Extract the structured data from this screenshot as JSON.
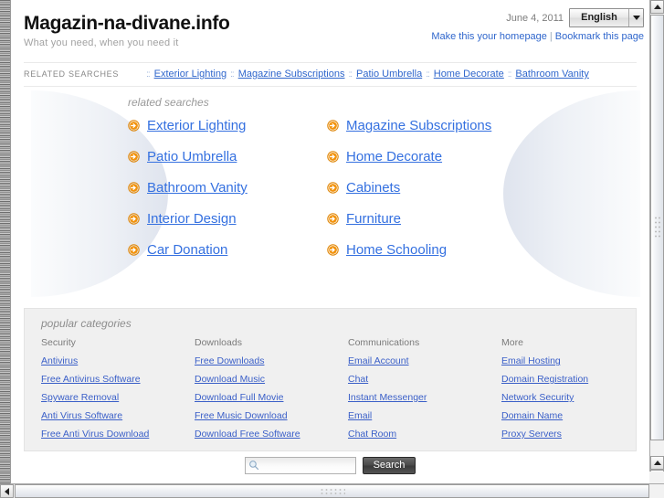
{
  "header": {
    "site_title": "Magazin-na-divane.info",
    "tagline": "What you need, when you need it",
    "date": "June 4, 2011",
    "language": "English",
    "homepage_link": "Make this your homepage",
    "separator": "|",
    "bookmark_link": "Bookmark this page"
  },
  "related_strip": {
    "label": "RELATED SEARCHES",
    "separator": "::",
    "items": [
      "Exterior Lighting",
      "Magazine Subscriptions",
      "Patio Umbrella",
      "Home Decorate",
      "Bathroom Vanity"
    ]
  },
  "hero": {
    "caption": "related searches",
    "links": [
      "Exterior Lighting",
      "Magazine Subscriptions",
      "Patio Umbrella",
      "Home Decorate",
      "Bathroom Vanity",
      "Cabinets",
      "Interior Design",
      "Furniture",
      "Car Donation",
      "Home Schooling"
    ]
  },
  "categories": {
    "caption": "popular categories",
    "columns": [
      {
        "heading": "Security",
        "links": [
          "Antivirus",
          "Free Antivirus Software",
          "Spyware Removal",
          "Anti Virus Software",
          "Free Anti Virus Download"
        ]
      },
      {
        "heading": "Downloads",
        "links": [
          "Free Downloads",
          "Download Music",
          "Download Full Movie",
          "Free Music Download",
          "Download Free Software"
        ]
      },
      {
        "heading": "Communications",
        "links": [
          "Email Account",
          "Chat",
          "Instant Messenger",
          "Email",
          "Chat Room"
        ]
      },
      {
        "heading": "More",
        "links": [
          "Email Hosting",
          "Domain Registration",
          "Network Security",
          "Domain Name",
          "Proxy Servers"
        ]
      }
    ]
  },
  "search": {
    "value": "",
    "placeholder": "",
    "button_label": "Search"
  },
  "colors": {
    "link_blue": "#2f66cc",
    "hero_link_blue": "#3470e0",
    "arrow_orange": "#f08a00",
    "muted_gray": "#9a9a9a",
    "panel_gray": "#f0f0f0"
  }
}
